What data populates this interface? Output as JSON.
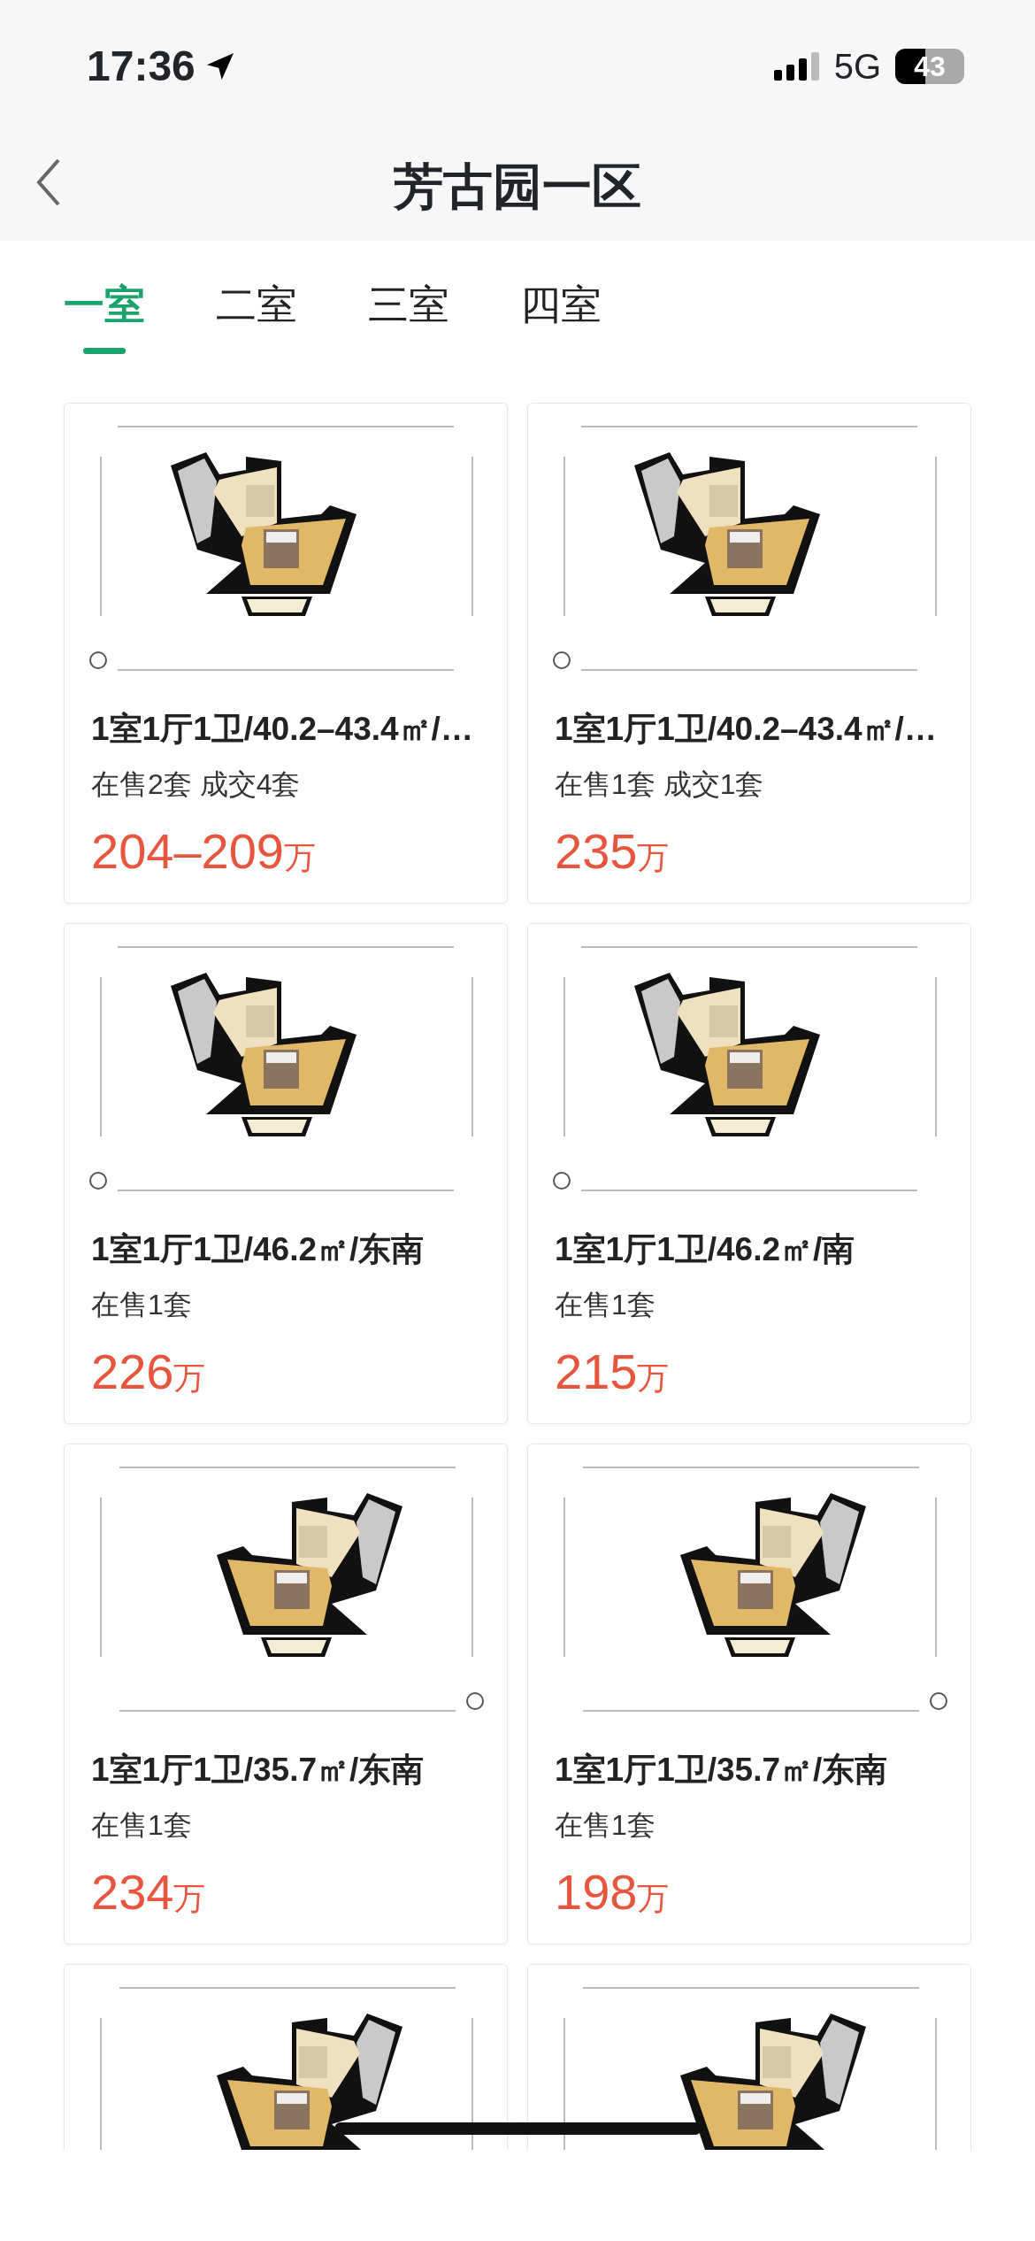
{
  "status_bar": {
    "time": "17:36",
    "network": "5G",
    "battery": "43"
  },
  "header": {
    "title": "芳古园一区"
  },
  "tabs": [
    {
      "label": "一室",
      "selected": true
    },
    {
      "label": "二室",
      "selected": false
    },
    {
      "label": "三室",
      "selected": false
    },
    {
      "label": "四室",
      "selected": false
    }
  ],
  "listings": [
    {
      "kind": "listing",
      "title": "1室1厅1卫/40.2–43.4㎡/…",
      "stats": "在售2套 成交4套",
      "price": "204–209",
      "unit": "万"
    },
    {
      "kind": "listing",
      "title": "1室1厅1卫/40.2–43.4㎡/…",
      "stats": "在售1套 成交1套",
      "price": "235",
      "unit": "万"
    },
    {
      "kind": "listing",
      "title": "1室1厅1卫/46.2㎡/东南",
      "stats": "在售1套",
      "price": "226",
      "unit": "万"
    },
    {
      "kind": "listing",
      "title": "1室1厅1卫/46.2㎡/南",
      "stats": "在售1套",
      "price": "215",
      "unit": "万"
    },
    {
      "kind": "listing",
      "title": "1室1厅1卫/35.7㎡/东南",
      "stats": "在售1套",
      "price": "234",
      "unit": "万"
    },
    {
      "kind": "listing",
      "title": "1室1厅1卫/35.7㎡/东南",
      "stats": "在售1套",
      "price": "198",
      "unit": "万"
    },
    {
      "kind": "picture"
    },
    {
      "kind": "picture"
    }
  ]
}
